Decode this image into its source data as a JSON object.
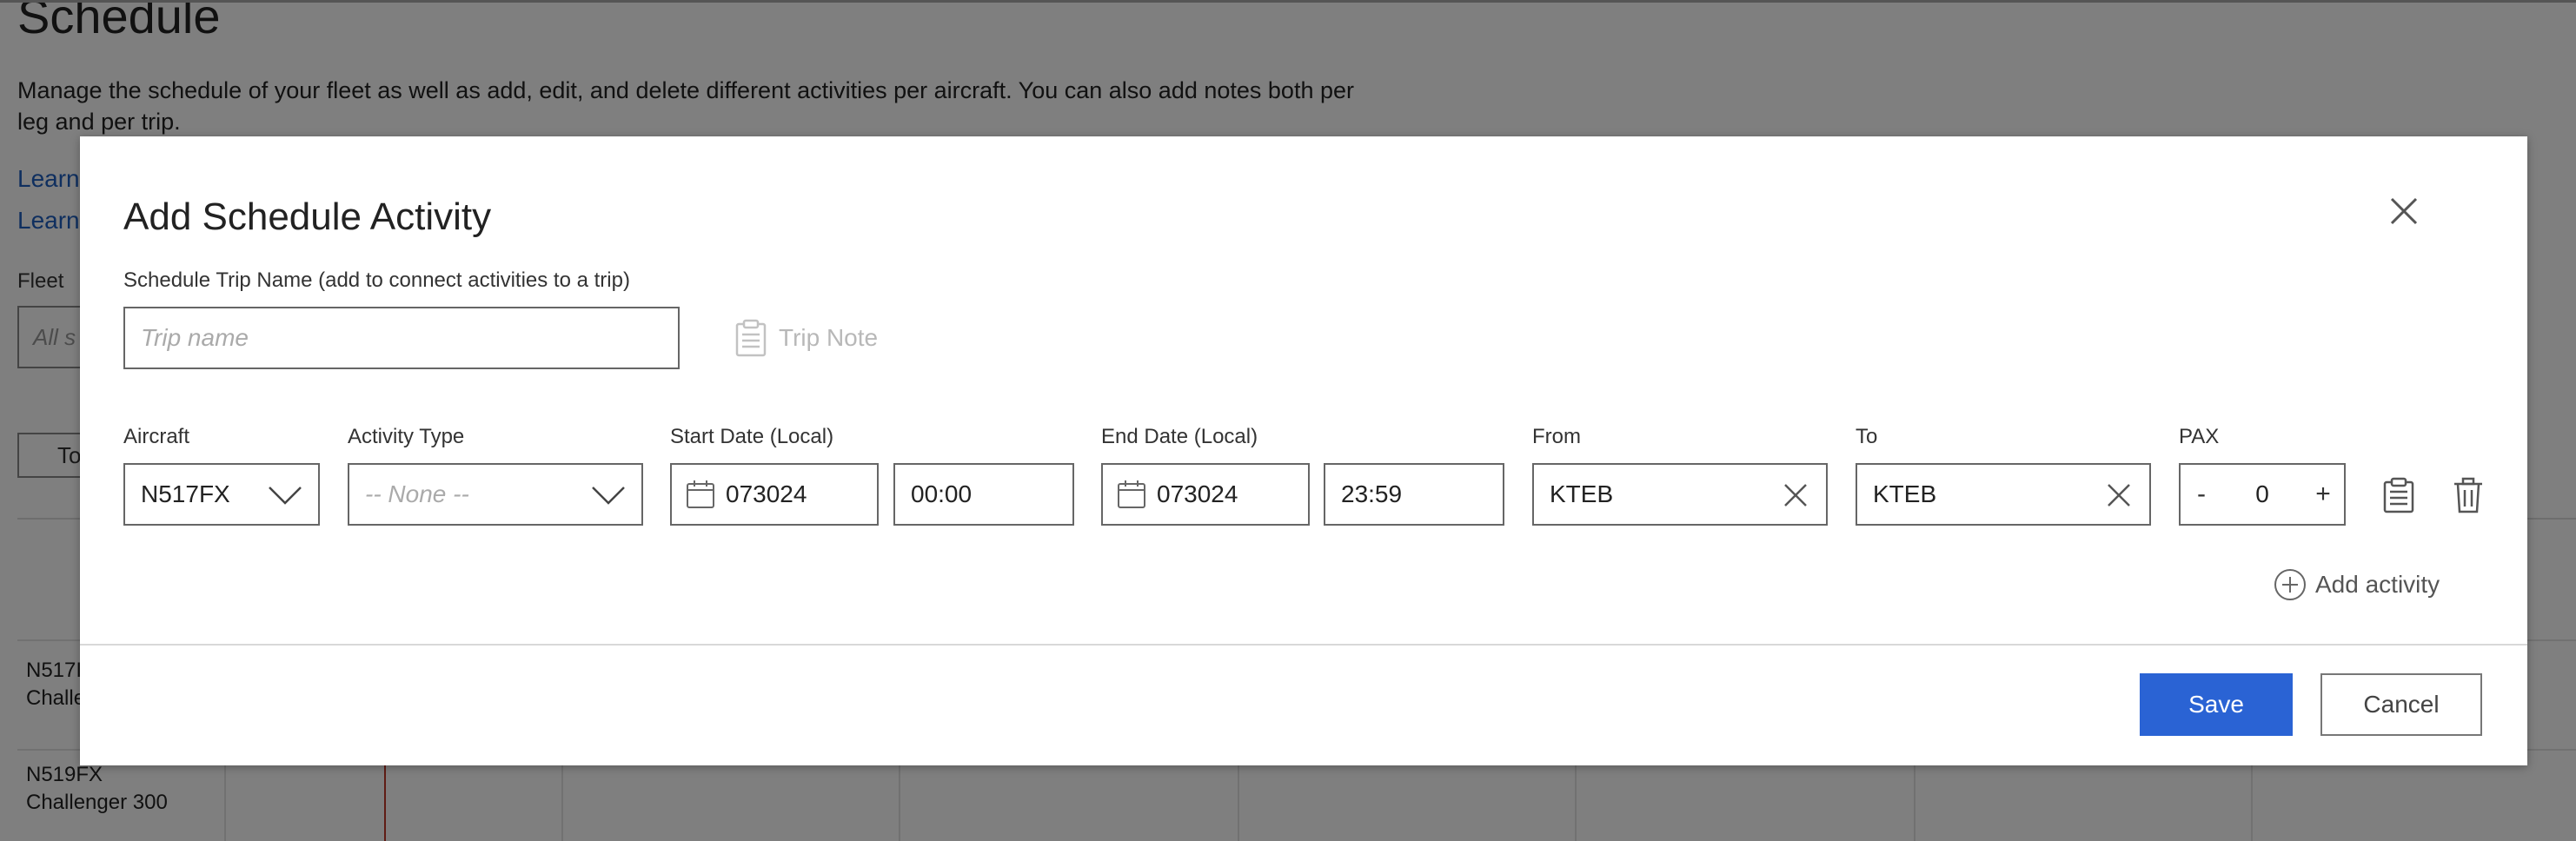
{
  "background": {
    "title": "Schedule",
    "description": "Manage the schedule of your fleet as well as add, edit, and delete different activities per aircraft. You can also add notes both per leg and per trip.",
    "links": [
      "Learn",
      "Learn"
    ],
    "fleet_label": "Fleet",
    "fleet_placeholder": "All s",
    "today_button": "To",
    "aircraft_rows": [
      {
        "tail": "N517I",
        "model": "Challe"
      },
      {
        "tail": "N519FX",
        "model": "Challenger 300"
      }
    ]
  },
  "modal": {
    "title": "Add Schedule Activity",
    "close_icon": "close-icon",
    "trip_name_label": "Schedule Trip Name (add to connect activities to a trip)",
    "trip_name_placeholder": "Trip name",
    "trip_name_value": "",
    "trip_note_label": "Trip Note",
    "activity": {
      "aircraft_label": "Aircraft",
      "aircraft_value": "N517FX",
      "activity_type_label": "Activity Type",
      "activity_type_value": "-- None --",
      "start_date_label": "Start Date (Local)",
      "start_date_value": "073024",
      "start_time_value": "00:00",
      "end_date_label": "End Date (Local)",
      "end_date_value": "073024",
      "end_time_value": "23:59",
      "from_label": "From",
      "from_value": "KTEB",
      "to_label": "To",
      "to_value": "KTEB",
      "pax_label": "PAX",
      "pax_value": "0",
      "pax_minus": "-",
      "pax_plus": "+",
      "note_icon": "clipboard-icon",
      "delete_icon": "trash-icon"
    },
    "add_activity_label": "Add activity",
    "save_label": "Save",
    "cancel_label": "Cancel"
  },
  "colors": {
    "primary": "#2a63d4",
    "overlay": "rgba(0,0,0,0.5)",
    "link": "#1f5fbf",
    "now_line": "#c0392b"
  }
}
